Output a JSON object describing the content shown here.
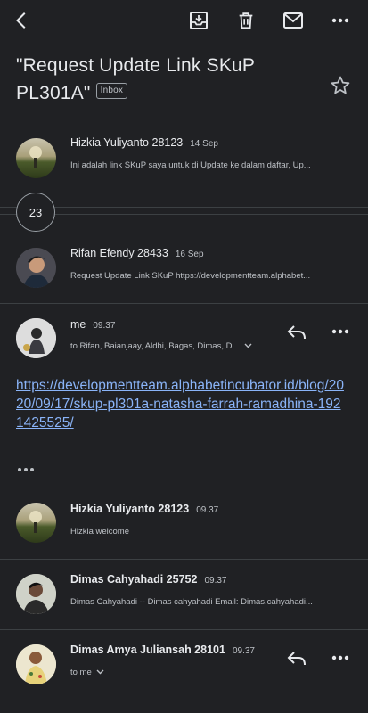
{
  "toolbar": {
    "back": "back-icon",
    "archive": "archive-icon",
    "delete": "trash-icon",
    "mark_unread": "mail-icon",
    "more": "more-icon"
  },
  "subject": {
    "text": "\"Request Update Link SKuP PL301A\"",
    "label": "Inbox"
  },
  "collapsed_count": "23",
  "messages": [
    {
      "sender": "Hizkia Yuliyanto 28123",
      "time": "14 Sep",
      "snippet": "Ini adalah link SKuP saya untuk di Update ke dalam daftar, Up..."
    },
    {
      "sender": "Rifan Efendy 28433",
      "time": "16 Sep",
      "snippet": "Request Update Link SKuP https://developmentteam.alphabet..."
    },
    {
      "sender": "me",
      "time": "09.37",
      "to": "to Rifan, Baianjaay, Aldhi, Bagas, Dimas, D...",
      "link": "https://developmentteam.alphabetincubator.id/blog/2020/09/17/skup-pl301a-natasha-farrah-ramadhina-1921425525/"
    },
    {
      "sender": "Hizkia Yuliyanto 28123",
      "time": "09.37",
      "snippet": "Hizkia welcome"
    },
    {
      "sender": "Dimas Cahyahadi 25752",
      "time": "09.37",
      "snippet": "Dimas Cahyahadi -- Dimas cahyahadi Email: Dimas.cahyahadi..."
    },
    {
      "sender": "Dimas Amya Juliansah 28101",
      "time": "09.37",
      "to": "to me"
    }
  ],
  "colors": {
    "background": "#202124",
    "link": "#8ab4f8",
    "divider": "#3c4043"
  }
}
